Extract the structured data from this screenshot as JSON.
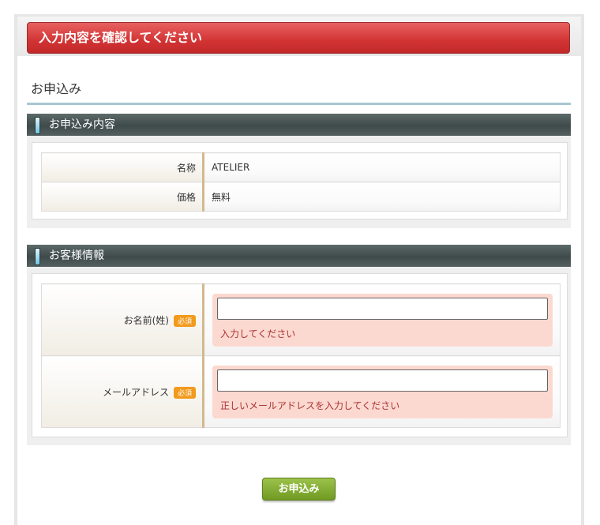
{
  "error_banner": "入力内容を確認してください",
  "page_title": "お申込み",
  "sections": {
    "application": {
      "title": "お申込み内容",
      "rows": [
        {
          "label": "名称",
          "value": "ATELIER"
        },
        {
          "label": "価格",
          "value": "無料"
        }
      ]
    },
    "customer": {
      "title": "お客様情報",
      "rows": [
        {
          "label": "お名前(姓)",
          "required": "必須",
          "value": "",
          "error": "入力してください"
        },
        {
          "label": "メールアドレス",
          "required": "必須",
          "value": "",
          "error": "正しいメールアドレスを入力してください"
        }
      ]
    }
  },
  "submit_label": "お申込み",
  "colors": {
    "banner": "#d23434",
    "error_bg": "#fcd9d0",
    "badge": "#f29a1c",
    "submit": "#7fa82e"
  }
}
